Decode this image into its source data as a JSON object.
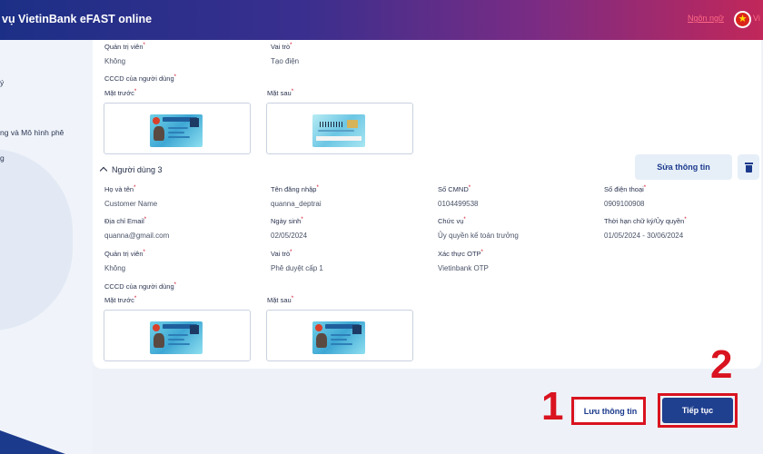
{
  "header": {
    "title": "vụ VietinBank eFAST online",
    "language_link": "Ngôn ngữ",
    "language_code": "Vi",
    "flag": "vietnam-flag-icon"
  },
  "sidebar": {
    "items": [
      {
        "label": "ý"
      },
      {
        "label": "ng và Mô hình phê"
      },
      {
        "label": "g"
      }
    ]
  },
  "user2": {
    "admin_label": "Quản trị viên",
    "admin_value": "Không",
    "role_label": "Vai trò",
    "role_value": "Tạo điện",
    "id_card_label": "CCCD của người dùng",
    "front_label": "Mặt trước",
    "back_label": "Mặt sau"
  },
  "user3": {
    "section_title": "Người dùng 3",
    "edit_button": "Sửa thông tin",
    "fullname_label": "Họ và tên",
    "fullname_value": "Customer Name",
    "username_label": "Tên đăng nhập",
    "username_value": "quanna_deptrai",
    "id_number_label": "Số CMND",
    "id_number_value": "0104499538",
    "phone_label": "Số điện thoại",
    "phone_value": "0909100908",
    "email_label": "Địa chỉ Email",
    "email_value": "quanna@gmail.com",
    "dob_label": "Ngày sinh",
    "dob_value": "02/05/2024",
    "position_label": "Chức vụ",
    "position_value": "Ủy quyền kế toán trưởng",
    "term_label": "Thời hạn chữ ký/Ủy quyền",
    "term_value": "01/05/2024 - 30/06/2024",
    "admin_label": "Quản trị viên",
    "admin_value": "Không",
    "role_label": "Vai trò",
    "role_value": "Phê duyệt cấp 1",
    "otp_label": "Xác thực OTP",
    "otp_value": "Vietinbank OTP",
    "id_card_label": "CCCD của người dùng",
    "front_label": "Mặt trước",
    "back_label": "Mặt sau"
  },
  "footer": {
    "save_button": "Lưu thông tin",
    "next_button": "Tiếp tục",
    "step_1": "1",
    "step_2": "2"
  },
  "colors": {
    "header_gradient_start": "#1c2f86",
    "header_gradient_end": "#c1275a",
    "primary": "#1f3f8f",
    "highlight": "#d9131f",
    "required": "#d0021b"
  }
}
